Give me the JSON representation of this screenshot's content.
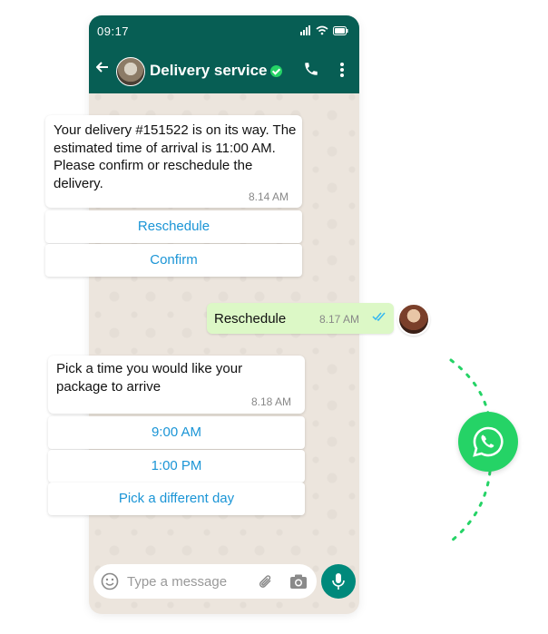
{
  "status_bar": {
    "time": "09:17"
  },
  "header": {
    "title": "Delivery service"
  },
  "messages": [
    {
      "text": "Your delivery #151522 is on its way. The estimated time of arrival is 11:00 AM. Please confirm or reschedule the delivery.",
      "time": "8.14 AM",
      "buttons": [
        "Reschedule",
        "Confirm"
      ]
    },
    {
      "text": "Reschedule",
      "time": "8.17 AM"
    },
    {
      "text": "Pick a time you would like your package to arrive",
      "time": "8.18 AM",
      "buttons": [
        "9:00 AM",
        "1:00 PM",
        "Pick a different day"
      ]
    }
  ],
  "composer": {
    "placeholder": "Type a message"
  },
  "colors": {
    "header": "#075e54",
    "outgoing_bubble": "#dcf8c6",
    "button_text": "#1b95d6",
    "whatsapp_green": "#25d366"
  }
}
